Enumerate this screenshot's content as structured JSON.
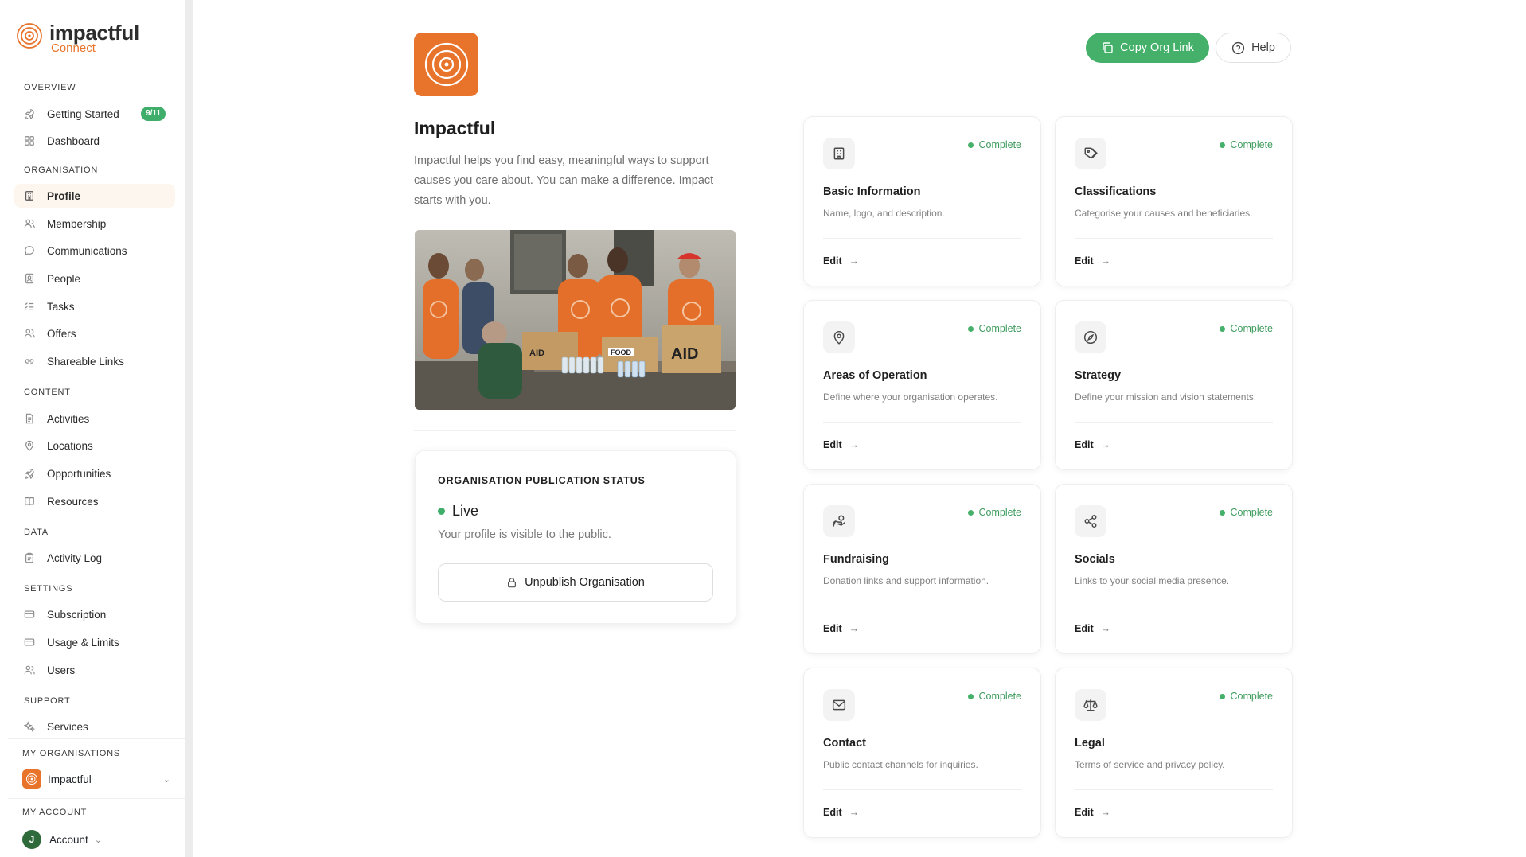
{
  "brand": {
    "name": "impactful",
    "sub": "Connect"
  },
  "sidebar": {
    "sections": {
      "overview": "OVERVIEW",
      "organisation": "ORGANISATION",
      "content": "CONTENT",
      "data": "DATA",
      "settings": "SETTINGS",
      "support": "SUPPORT",
      "my_organisations": "MY ORGANISATIONS",
      "my_account": "MY ACCOUNT"
    },
    "items": {
      "getting_started": {
        "label": "Getting Started",
        "badge": "9/11",
        "icon": "rocket-icon"
      },
      "dashboard": {
        "label": "Dashboard",
        "icon": "grid-icon"
      },
      "profile": {
        "label": "Profile",
        "icon": "building-icon"
      },
      "membership": {
        "label": "Membership",
        "icon": "users-icon"
      },
      "communications": {
        "label": "Communications",
        "icon": "chat-icon"
      },
      "people": {
        "label": "People",
        "icon": "contact-icon"
      },
      "tasks": {
        "label": "Tasks",
        "icon": "list-check-icon"
      },
      "offers": {
        "label": "Offers",
        "icon": "users-icon"
      },
      "shareable_links": {
        "label": "Shareable Links",
        "icon": "link-icon"
      },
      "activities": {
        "label": "Activities",
        "icon": "document-icon"
      },
      "locations": {
        "label": "Locations",
        "icon": "map-pin-icon"
      },
      "opportunities": {
        "label": "Opportunities",
        "icon": "rocket-icon"
      },
      "resources": {
        "label": "Resources",
        "icon": "book-icon"
      },
      "activity_log": {
        "label": "Activity Log",
        "icon": "clipboard-icon"
      },
      "subscription": {
        "label": "Subscription",
        "icon": "card-icon"
      },
      "usage_limits": {
        "label": "Usage & Limits",
        "icon": "card-icon"
      },
      "users": {
        "label": "Users",
        "icon": "users-icon"
      },
      "services": {
        "label": "Services",
        "icon": "sparkle-icon"
      }
    },
    "org_select": {
      "value": "Impactful"
    },
    "account": {
      "initial": "J",
      "label": "Account"
    }
  },
  "header": {
    "copy_link_label": "Copy Org Link",
    "help_label": "Help"
  },
  "org": {
    "name": "Impactful",
    "description": "Impactful helps you find easy, meaningful ways to support causes you care about. You can make a difference. Impact starts with you.",
    "photo_box_labels": [
      "AID",
      "FOOD",
      "AID"
    ]
  },
  "publication": {
    "title": "ORGANISATION PUBLICATION STATUS",
    "state": "Live",
    "message": "Your profile is visible to the public.",
    "button_label": "Unpublish Organisation"
  },
  "cards": [
    {
      "title": "Basic Information",
      "desc": "Name, logo, and description.",
      "status": "Complete",
      "edit": "Edit",
      "icon": "building-icon"
    },
    {
      "title": "Classifications",
      "desc": "Categorise your causes and beneficiaries.",
      "status": "Complete",
      "edit": "Edit",
      "icon": "tag-icon"
    },
    {
      "title": "Areas of Operation",
      "desc": "Define where your organisation operates.",
      "status": "Complete",
      "edit": "Edit",
      "icon": "map-pin-icon"
    },
    {
      "title": "Strategy",
      "desc": "Define your mission and vision statements.",
      "status": "Complete",
      "edit": "Edit",
      "icon": "compass-icon"
    },
    {
      "title": "Fundraising",
      "desc": "Donation links and support information.",
      "status": "Complete",
      "edit": "Edit",
      "icon": "hand-coins-icon"
    },
    {
      "title": "Socials",
      "desc": "Links to your social media presence.",
      "status": "Complete",
      "edit": "Edit",
      "icon": "share-icon"
    },
    {
      "title": "Contact",
      "desc": "Public contact channels for inquiries.",
      "status": "Complete",
      "edit": "Edit",
      "icon": "mail-icon"
    },
    {
      "title": "Legal",
      "desc": "Terms of service and privacy policy.",
      "status": "Complete",
      "edit": "Edit",
      "icon": "scale-icon"
    }
  ],
  "colors": {
    "brand_orange": "#e8742c",
    "accent_green": "#44b06a",
    "active_bg": "#fdf6ee"
  }
}
